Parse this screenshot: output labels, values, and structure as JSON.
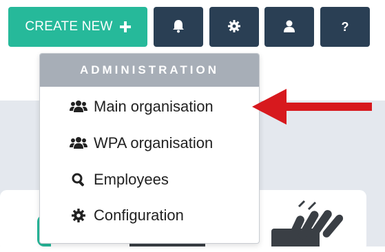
{
  "toolbar": {
    "create_new_label": "CREATE NEW",
    "help_label": "?"
  },
  "admin_menu": {
    "header": "ADMINISTRATION",
    "items": [
      {
        "label": "Main organisation",
        "icon": "users-icon"
      },
      {
        "label": "WPA organisation",
        "icon": "users-icon"
      },
      {
        "label": "Employees",
        "icon": "search-icon"
      },
      {
        "label": "Configuration",
        "icon": "gear-icon"
      }
    ]
  },
  "colors": {
    "accent": "#26b99a",
    "navbar_button": "#2a3f54",
    "menu_header": "#a7aeb7",
    "arrow": "#d7191e"
  }
}
